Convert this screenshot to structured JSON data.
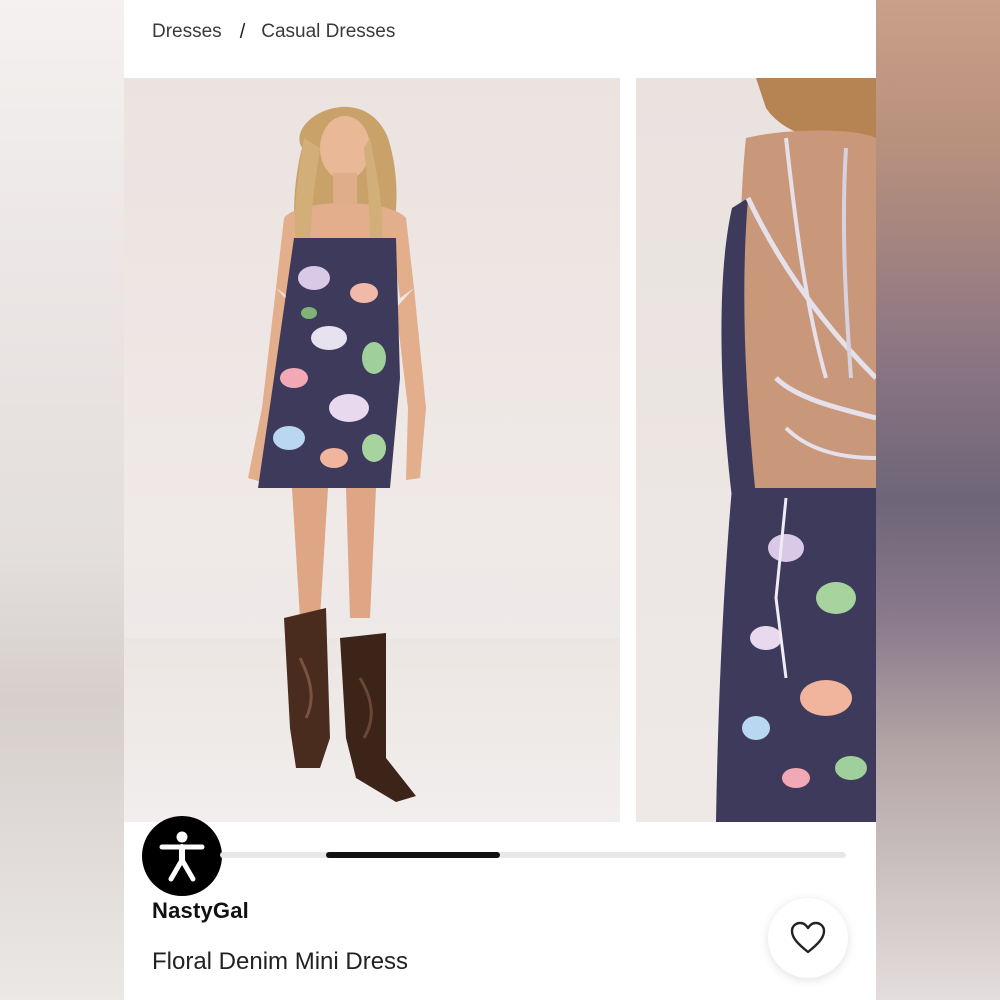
{
  "breadcrumb": {
    "items": [
      "Dresses",
      "Casual Dresses"
    ],
    "separator": "/"
  },
  "gallery": {
    "images": [
      {
        "icon": "model-front-photo"
      },
      {
        "icon": "model-back-photo"
      }
    ],
    "scroll_progress": 0.3
  },
  "product": {
    "brand": "NastyGal",
    "title": "Floral Denim Mini Dress"
  },
  "icons": {
    "accessibility": "accessibility-icon",
    "favorite": "heart-icon"
  },
  "colors": {
    "accent": "#111111",
    "dress_base": "#3e3a5c"
  }
}
